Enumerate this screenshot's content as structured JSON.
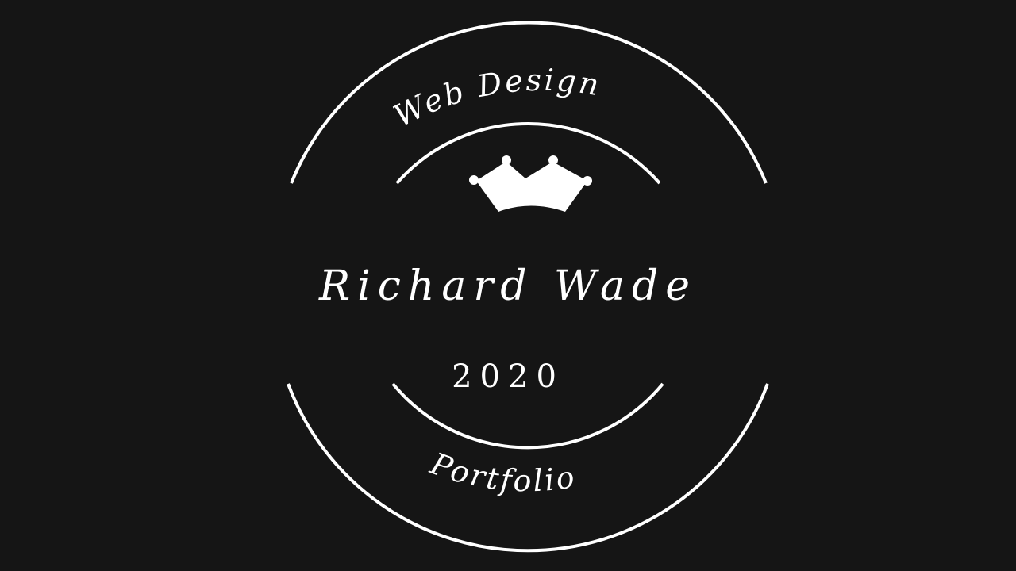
{
  "badge": {
    "top_arc_text": "Web Design",
    "name": "Richard Wade",
    "year": "2020",
    "bottom_arc_text": "Portfolio",
    "icon": "crown-icon",
    "colors": {
      "background": "#151515",
      "foreground": "#ffffff"
    }
  }
}
